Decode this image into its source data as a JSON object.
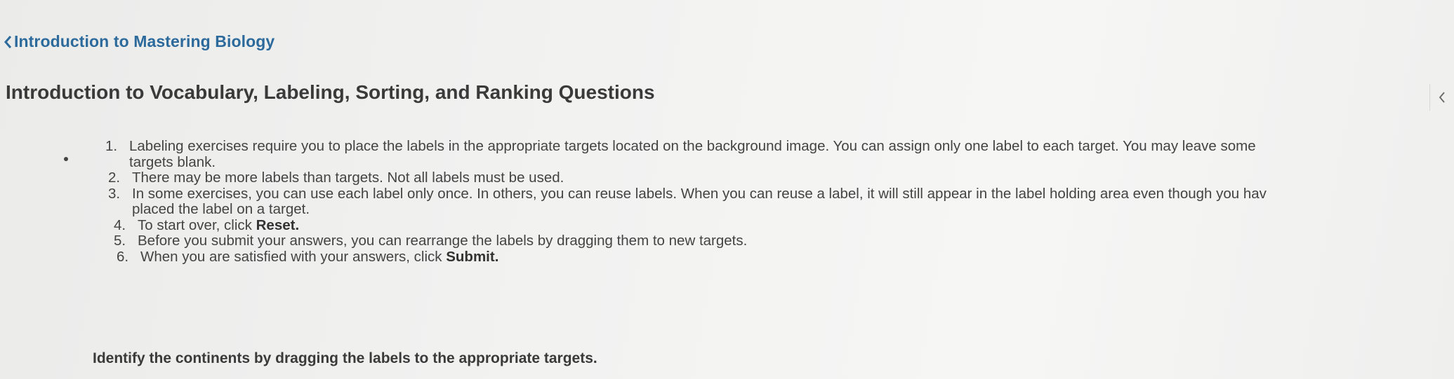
{
  "nav": {
    "back_label": "Introduction to Mastering Biology"
  },
  "header": {
    "title": "Introduction to Vocabulary, Labeling, Sorting, and Ranking Questions"
  },
  "instructions": {
    "items": [
      {
        "num": "1.",
        "text": "Labeling exercises require you to place the labels in the appropriate targets located on the background image. You can assign only one label to each target. You may leave some",
        "cont": "targets blank."
      },
      {
        "num": "2.",
        "text": "There may be more labels than targets. Not all labels must be used."
      },
      {
        "num": "3.",
        "text": "In some exercises, you can use each label only once. In others, you can reuse labels. When you can reuse a label, it will still appear in the label holding area even though you hav",
        "cont": "placed the label on a target."
      },
      {
        "num": "4.",
        "text": "To start over, click ",
        "bold": "Reset."
      },
      {
        "num": "5.",
        "text": "Before you submit your answers, you can rearrange the labels by dragging them to new targets."
      },
      {
        "num": "6.",
        "text": "When you are satisfied with your answers, click ",
        "bold": "Submit."
      }
    ]
  },
  "main": {
    "prompt": "Identify the continents by dragging the labels to the appropriate targets."
  },
  "colors": {
    "link": "#2c6a9c",
    "text": "#444444",
    "heading": "#3a3a3a",
    "background": "#f1f1ef"
  },
  "icons": {
    "back": "chevron-left-icon",
    "collapse": "chevron-left-icon"
  }
}
